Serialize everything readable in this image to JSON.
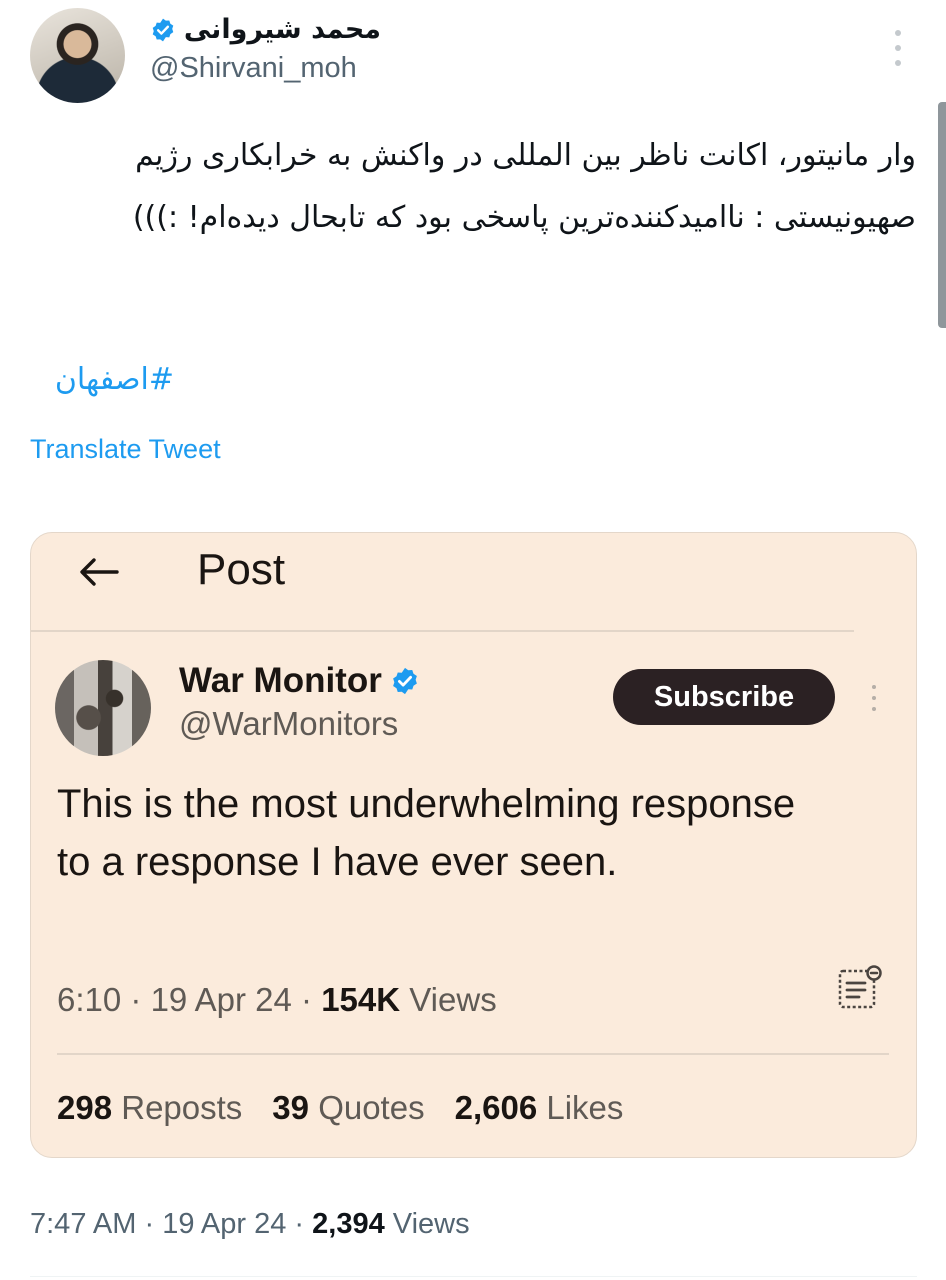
{
  "author": {
    "display_name": "محمد شیروانی",
    "handle": "@Shirvani_moh",
    "verified_color": "#1d9bf0",
    "avatar_icon": "profile-photo"
  },
  "tweet": {
    "text": "وار مانیتور، اکانت ناظر بین المللی در واکنش به خرابکاری رژیم صهیونیستی : ناامیدکننده‌ترین پاسخی بود که تابحال دیده‌ام! :)))",
    "hashtag": "#اصفهان",
    "translate_label": "Translate Tweet",
    "time": "7:47 AM",
    "date": "19 Apr 24",
    "views_count": "2,394",
    "views_label": "Views"
  },
  "quoted_screenshot": {
    "header_title": "Post",
    "back_icon": "arrow-left-icon",
    "author": {
      "display_name": "War Monitor",
      "handle": "@WarMonitors",
      "verified_color": "#1d9bf0"
    },
    "subscribe_label": "Subscribe",
    "text": "This is the most underwhelming response to a response I have ever seen.",
    "time": "6:10",
    "date": "19 Apr 24",
    "views_count": "154K",
    "views_label": "Views",
    "reposts_count": "298",
    "reposts_label": "Reposts",
    "quotes_count": "39",
    "quotes_label": "Quotes",
    "likes_count": "2,606",
    "likes_label": "Likes",
    "card_background": "#fbebdc",
    "subscribe_background": "#2b2123"
  },
  "separator": "·"
}
